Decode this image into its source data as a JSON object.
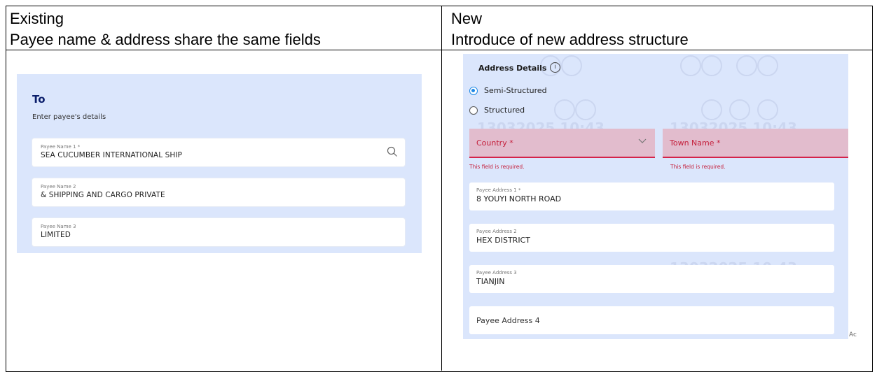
{
  "table": {
    "existing_heading": "Existing",
    "existing_subheading": "Payee name & address share the same fields",
    "new_heading": "New",
    "new_subheading": "Introduce of new address structure"
  },
  "existing_form": {
    "title": "To",
    "subtitle": "Enter payee's details",
    "fields": [
      {
        "label": "Payee Name 1 *",
        "value": "SEA CUCUMBER INTERNATIONAL SHIP"
      },
      {
        "label": "Payee Name 2",
        "value": "& SHIPPING AND CARGO PRIVATE"
      },
      {
        "label": "Payee Name 3",
        "value": "LIMITED"
      }
    ]
  },
  "new_form": {
    "section_title": "Address Details",
    "info_icon_glyph": "i",
    "radio_options": [
      {
        "label": "Semi-Structured",
        "selected": true
      },
      {
        "label": "Structured",
        "selected": false
      }
    ],
    "country": {
      "placeholder": "Country *",
      "error": "This field is required."
    },
    "town": {
      "placeholder": "Town Name *",
      "error": "This field is required."
    },
    "address_fields": [
      {
        "label": "Payee Address 1 *",
        "value": "8 YOUYI NORTH ROAD"
      },
      {
        "label": "Payee Address 2",
        "value": "HEX DISTRICT"
      },
      {
        "label": "Payee Address 3",
        "value": "TIANJIN"
      },
      {
        "placeholder": "Payee Address 4"
      }
    ],
    "watermark_text": "13032025 10:43",
    "corner_text": "Ac",
    "colors": {
      "panel_bg": "#dbe6fc",
      "error": "#c41e3a",
      "radio_selected": "#1e88e5",
      "error_field_bg": "#e2bccd"
    }
  }
}
